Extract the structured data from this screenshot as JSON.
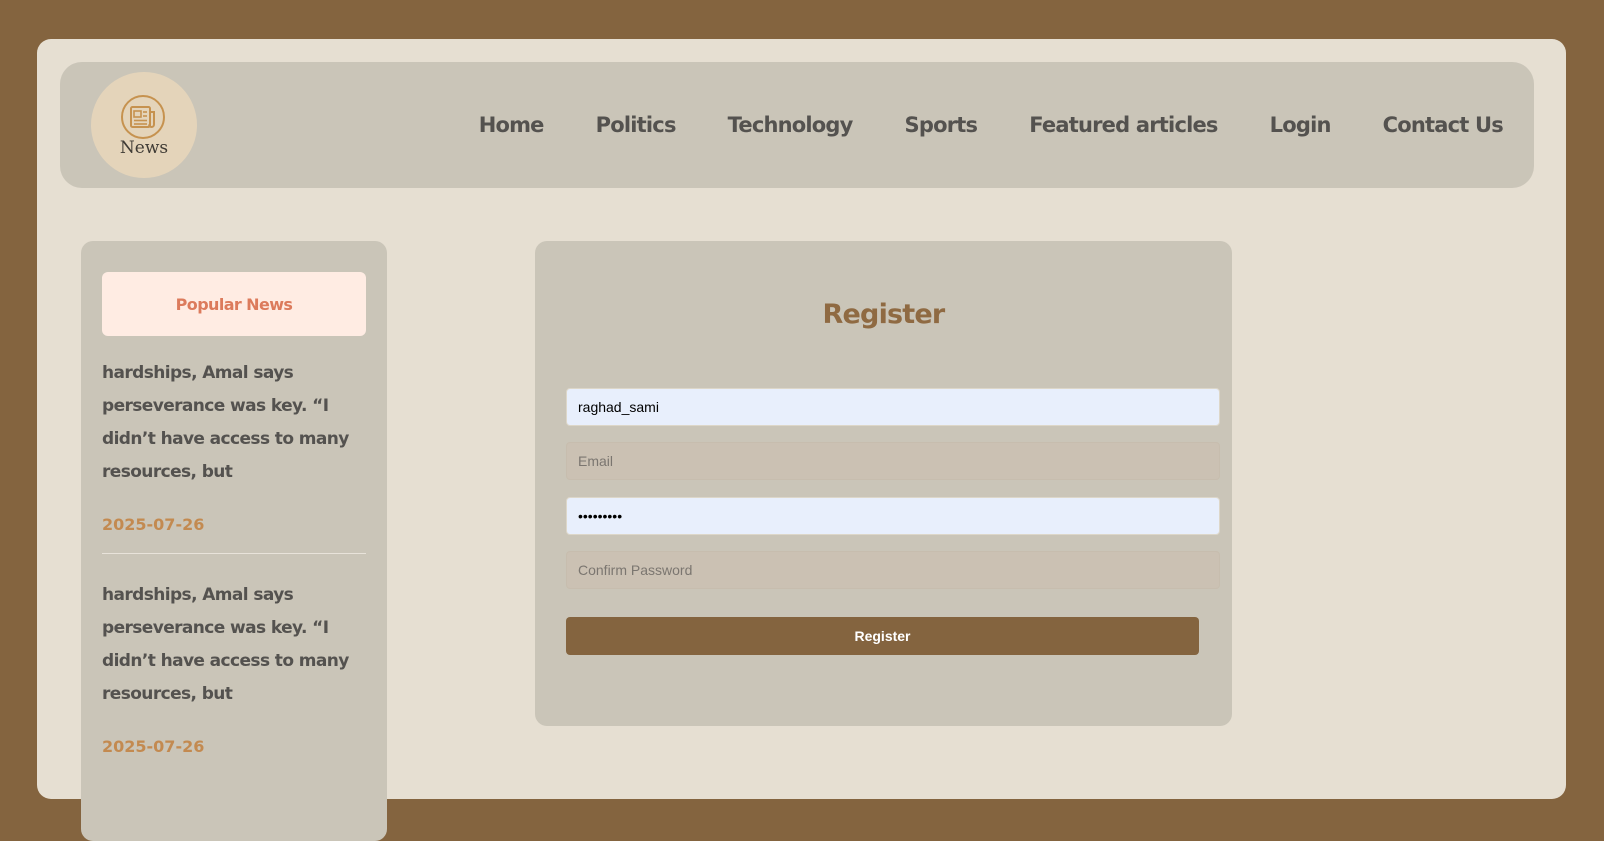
{
  "logo": {
    "text": "News"
  },
  "nav": {
    "items": [
      {
        "label": "Home"
      },
      {
        "label": "Politics"
      },
      {
        "label": "Technology"
      },
      {
        "label": "Sports"
      },
      {
        "label": "Featured articles"
      },
      {
        "label": "Login"
      },
      {
        "label": "Contact Us"
      }
    ]
  },
  "sidebar": {
    "title": "Popular News",
    "items": [
      {
        "text": "hardships, Amal says perseverance was key. “I didn’t have access to many resources, but",
        "date": "2025-07-26"
      },
      {
        "text": "hardships, Amal says perseverance was key. “I didn’t have access to many resources, but",
        "date": "2025-07-26"
      }
    ]
  },
  "form": {
    "title": "Register",
    "username": {
      "value": "raghad_sami"
    },
    "email": {
      "value": "",
      "placeholder": "Email"
    },
    "password": {
      "value": "•••••••••"
    },
    "confirm_password": {
      "value": "",
      "placeholder": "Confirm Password"
    },
    "submit_label": "Register"
  },
  "colors": {
    "outer_background": "#84643f",
    "page_background": "#e6dfd2",
    "panel": "#cac5b8",
    "accent_brown": "#84643f",
    "popular_title": "#dc7b5c",
    "date": "#c38a50"
  }
}
